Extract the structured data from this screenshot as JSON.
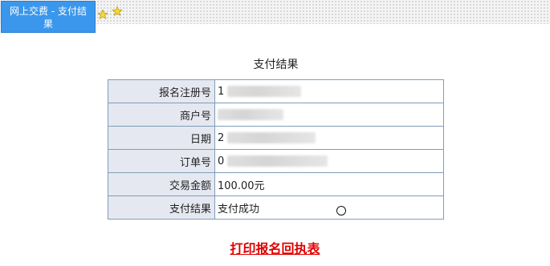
{
  "tab": {
    "label": "网上交费 - 支付结果"
  },
  "icons": [
    "star-icon",
    "star-icon"
  ],
  "page": {
    "title": "支付结果"
  },
  "result_table": {
    "rows": [
      {
        "label": "报名注册号",
        "value": "1",
        "redacted": true
      },
      {
        "label": "商户号",
        "value": "",
        "redacted": true
      },
      {
        "label": "日期",
        "value": "2",
        "redacted": true
      },
      {
        "label": "订单号",
        "value": "0",
        "redacted": true
      },
      {
        "label": "交易金额",
        "value": "100.00元",
        "redacted": false
      },
      {
        "label": "支付结果",
        "value": "支付成功",
        "redacted": false
      }
    ]
  },
  "actions": {
    "print_label": "打印报名回执表"
  },
  "colors": {
    "tab_bg": "#3b97ec",
    "label_bg": "#e5e8f0",
    "border": "#7f9db9",
    "link": "#e00000"
  }
}
